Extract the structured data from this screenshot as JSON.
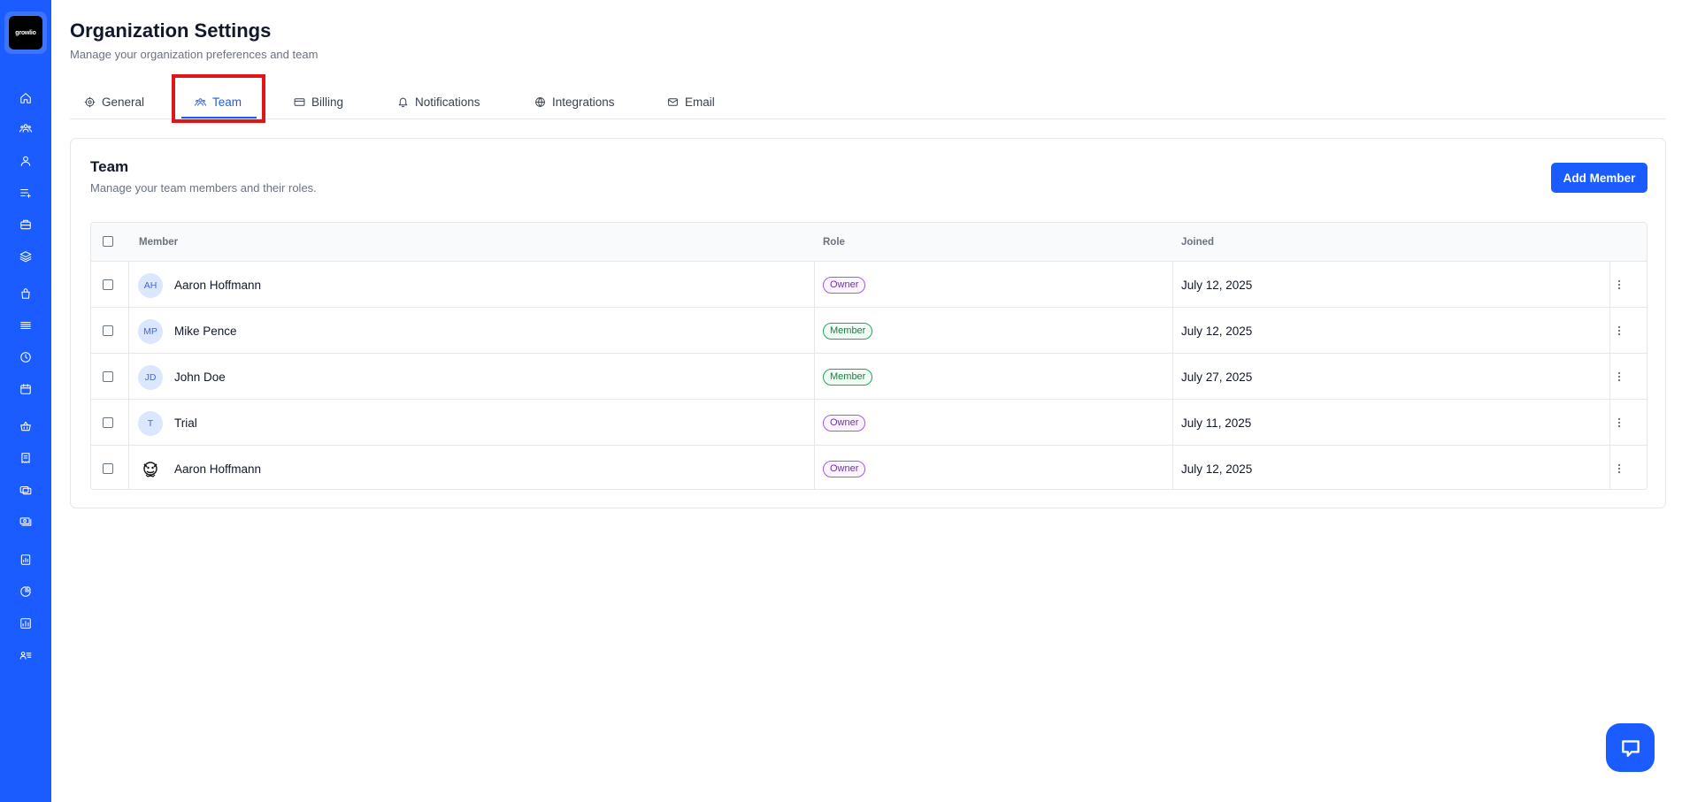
{
  "brand": {
    "logo_text": "growlio",
    "accent": "#1a5cff"
  },
  "sidebar": {
    "items": [
      {
        "icon": "home-icon"
      },
      {
        "icon": "team-icon"
      },
      {
        "icon": "user-icon"
      },
      {
        "icon": "list-add-icon"
      },
      {
        "icon": "briefcase-icon"
      },
      {
        "icon": "layers-icon"
      },
      {
        "icon": "bag-icon"
      },
      {
        "icon": "menu-icon"
      },
      {
        "icon": "clock-icon"
      },
      {
        "icon": "calendar-icon"
      },
      {
        "icon": "basket-icon"
      },
      {
        "icon": "receipt-icon"
      },
      {
        "icon": "cards-icon"
      },
      {
        "icon": "money-icon"
      },
      {
        "icon": "report-icon"
      },
      {
        "icon": "pie-chart-icon"
      },
      {
        "icon": "chart-icon"
      },
      {
        "icon": "user-list-icon"
      }
    ]
  },
  "header": {
    "title": "Organization Settings",
    "subtitle": "Manage your organization preferences and team"
  },
  "tabs": [
    {
      "label": "General",
      "icon": "gear-icon",
      "active": false
    },
    {
      "label": "Team",
      "icon": "team-icon",
      "active": true
    },
    {
      "label": "Billing",
      "icon": "credit-card-icon",
      "active": false
    },
    {
      "label": "Notifications",
      "icon": "bell-icon",
      "active": false
    },
    {
      "label": "Integrations",
      "icon": "globe-icon",
      "active": false
    },
    {
      "label": "Email",
      "icon": "mail-icon",
      "active": false
    }
  ],
  "team": {
    "title": "Team",
    "subtitle": "Manage your team members and their roles.",
    "add_label": "Add Member",
    "columns": {
      "member": "Member",
      "role": "Role",
      "joined": "Joined"
    },
    "rows": [
      {
        "initials": "AH",
        "name": "Aaron Hoffmann",
        "role": "Owner",
        "joined": "July 12, 2025"
      },
      {
        "initials": "MP",
        "name": "Mike Pence",
        "role": "Member",
        "joined": "July 12, 2025"
      },
      {
        "initials": "JD",
        "name": "John Doe",
        "role": "Member",
        "joined": "July 27, 2025"
      },
      {
        "initials": "T",
        "name": "Trial",
        "role": "Owner",
        "joined": "July 11, 2025"
      },
      {
        "initials": "",
        "name": "Aaron Hoffmann",
        "role": "Owner",
        "joined": "July 12, 2025",
        "avatar_image": true
      }
    ]
  },
  "colors": {
    "owner": "#7e22ce",
    "member": "#15803d",
    "highlight": "#e0151c"
  }
}
